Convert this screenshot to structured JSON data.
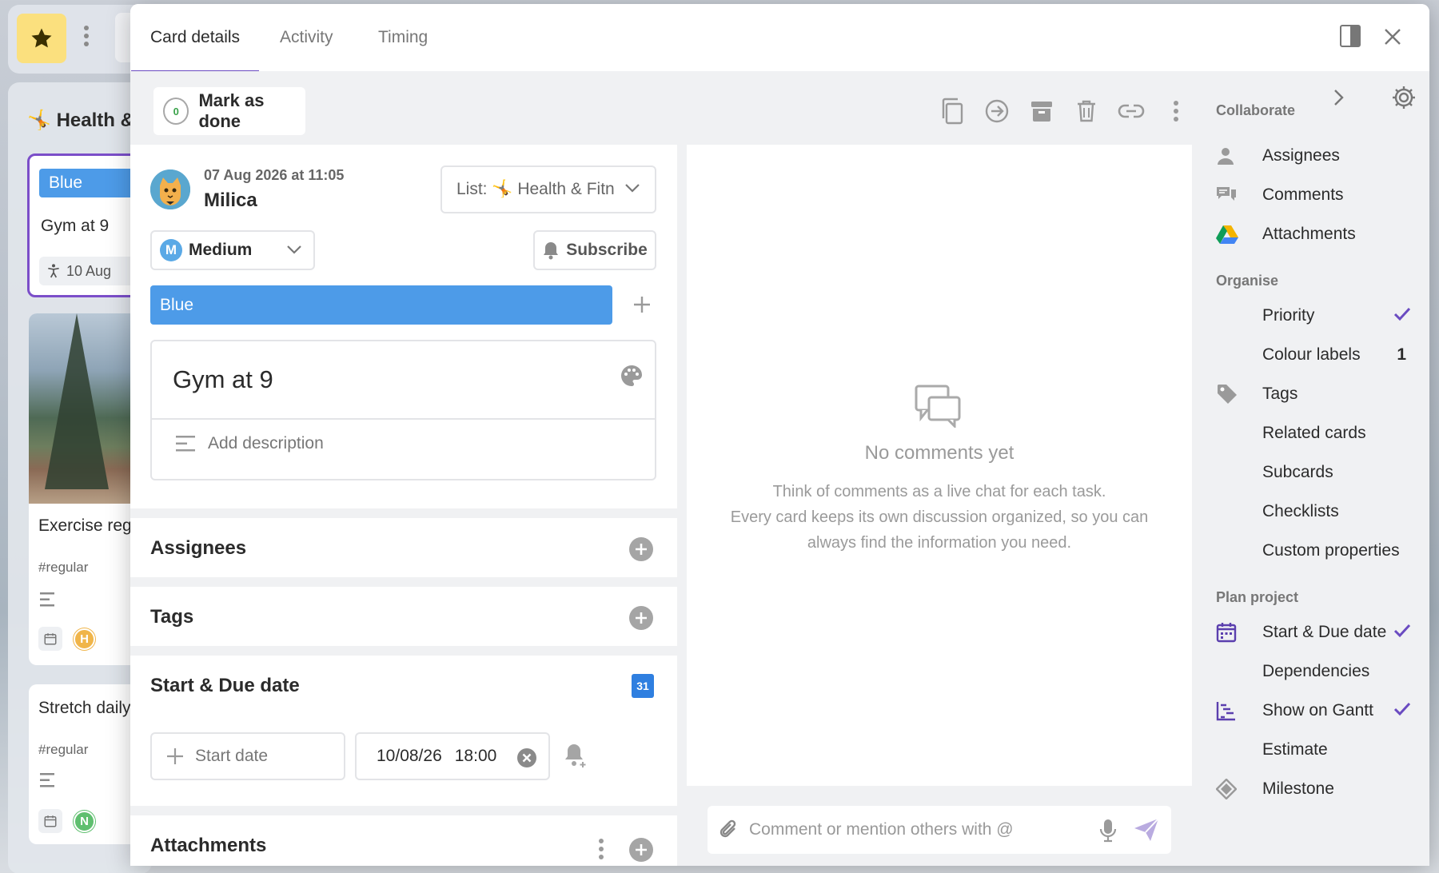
{
  "background": {
    "list_title": "Health &",
    "cards": [
      {
        "label": "Blue",
        "title": "Gym at 9",
        "chip": "10 Aug"
      },
      {
        "title": "Exercise reg",
        "tag": "#regular",
        "avatar": "H"
      },
      {
        "title": "Stretch daily",
        "tag": "#regular",
        "avatar": "N"
      }
    ]
  },
  "tabs": [
    {
      "label": "Card details",
      "active": true
    },
    {
      "label": "Activity"
    },
    {
      "label": "Timing"
    }
  ],
  "toolbar": {
    "mark_done_count": "0",
    "mark_done_label": "Mark as done",
    "icons": [
      "copy-icon",
      "move-icon",
      "archive-icon",
      "delete-icon",
      "link-icon",
      "more-icon"
    ]
  },
  "card": {
    "created": "07 Aug 2026 at 11:05",
    "author": "Milica",
    "list_select": "List: 🤸 Health & Fitn",
    "priority_badge": "M",
    "priority": "Medium",
    "subscribe": "Subscribe",
    "label": "Blue",
    "title": "Gym at 9",
    "description_placeholder": "Add description"
  },
  "sections": {
    "assignees": "Assignees",
    "tags": "Tags",
    "dates": "Start & Due date",
    "calendar_day": "31",
    "start_placeholder": "Start date",
    "due_date": "10/08/26",
    "due_time": "18:00",
    "attachments": "Attachments"
  },
  "comments": {
    "empty_title": "No comments yet",
    "empty_line1": "Think of comments as a live chat for each task.",
    "empty_line2": "Every card keeps its own discussion organized, so you can",
    "empty_line3": "always find the information you need.",
    "input_placeholder": "Comment or mention others with @"
  },
  "sidebar": {
    "collaborate_title": "Collaborate",
    "collaborate": [
      {
        "label": "Assignees",
        "icon": "person-icon"
      },
      {
        "label": "Comments",
        "icon": "comments-icon"
      },
      {
        "label": "Attachments",
        "icon": "drive-icon"
      }
    ],
    "organise_title": "Organise",
    "organise": [
      {
        "label": "Priority",
        "checked": true
      },
      {
        "label": "Colour labels",
        "count": "1"
      },
      {
        "label": "Tags",
        "icon": "tag-icon"
      },
      {
        "label": "Related cards"
      },
      {
        "label": "Subcards"
      },
      {
        "label": "Checklists"
      },
      {
        "label": "Custom properties"
      }
    ],
    "plan_title": "Plan project",
    "plan": [
      {
        "label": "Start & Due date",
        "icon": "calendar-icon",
        "checked": true
      },
      {
        "label": "Dependencies"
      },
      {
        "label": "Show on Gantt",
        "icon": "gantt-icon",
        "checked": true
      },
      {
        "label": "Estimate"
      },
      {
        "label": "Milestone",
        "icon": "milestone-icon"
      }
    ]
  },
  "colors": {
    "accent": "#6a4bc1",
    "label_blue": "#4d9be8",
    "priority_blue": "#5aa9e6",
    "star_yellow": "#fbe07e"
  }
}
